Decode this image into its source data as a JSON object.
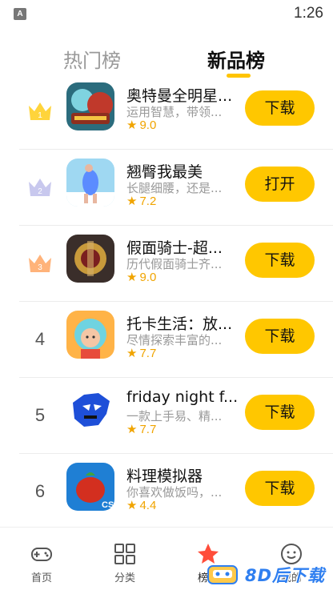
{
  "status": {
    "badge": "A",
    "time": "1:26"
  },
  "tabs": {
    "hot": "热门榜",
    "new": "新品榜"
  },
  "apps": [
    {
      "rank": "1",
      "name": "奥特曼全明星...",
      "desc": "运用智慧，带领...",
      "rating": "9.0",
      "action": "下载"
    },
    {
      "rank": "2",
      "name": "翘臀我最美",
      "desc": "长腿细腰，还是...",
      "rating": "7.2",
      "action": "打开"
    },
    {
      "rank": "3",
      "name": "假面骑士-超...",
      "desc": "历代假面骑士齐...",
      "rating": "9.0",
      "action": "下载"
    },
    {
      "rank": "4",
      "name": "托卡生活：放...",
      "desc": "尽情探索丰富的...",
      "rating": "7.7",
      "action": "下载"
    },
    {
      "rank": "5",
      "name": "friday night f...",
      "desc": "一款上手易、精...",
      "rating": "7.7",
      "action": "下载"
    },
    {
      "rank": "6",
      "name": "料理模拟器",
      "desc": "你喜欢做饭吗，...",
      "rating": "4.4",
      "action": "下载"
    }
  ],
  "nav": {
    "home": "首页",
    "category": "分类",
    "ranking": "榜单",
    "mine": "我的"
  },
  "watermark": {
    "text": "8D后下载"
  },
  "colors": {
    "accent": "#ffc700",
    "rating": "#f0a400",
    "gold": "#ffd43b",
    "silver": "#c8c8ee",
    "bronze": "#ffb37a"
  }
}
